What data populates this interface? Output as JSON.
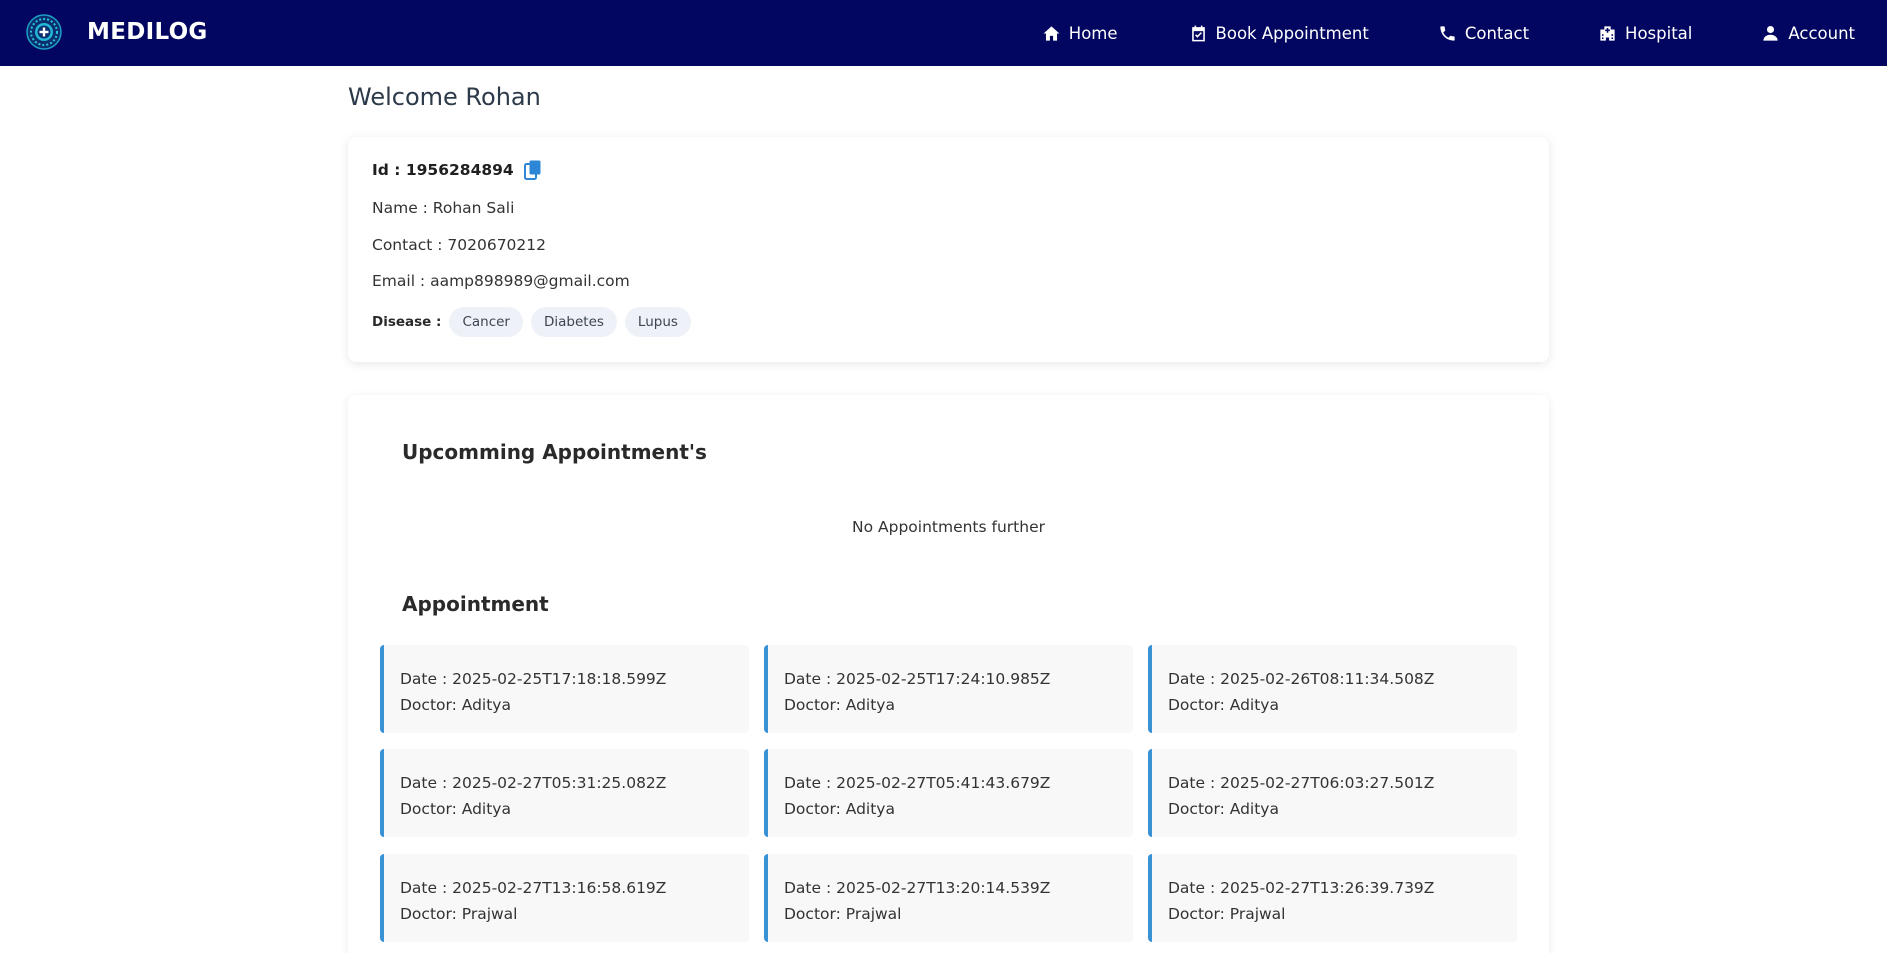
{
  "brand": {
    "name": "MEDILOG",
    "logo_icon": "medical-cross-icon"
  },
  "colors": {
    "navbar": "#020660",
    "accent": "#3a92d4",
    "chip_bg": "#eef2f8",
    "card_bg": "#f8f8f8"
  },
  "nav": [
    {
      "label": "Home",
      "icon": "home-icon"
    },
    {
      "label": "Book Appointment",
      "icon": "calendar-check-icon"
    },
    {
      "label": "Contact",
      "icon": "phone-icon"
    },
    {
      "label": "Hospital",
      "icon": "hospital-icon"
    },
    {
      "label": "Account",
      "icon": "user-icon"
    }
  ],
  "welcome": "Welcome Rohan",
  "profile": {
    "id": "Id : 1956284894",
    "name": "Name : Rohan Sali",
    "contact": "Contact : 7020670212",
    "email": "Email : aamp898989@gmail.com",
    "disease_label": "Disease :",
    "diseases": [
      "Cancer",
      "Diabetes",
      "Lupus"
    ]
  },
  "upcoming": {
    "heading": "Upcomming Appointment's",
    "empty_message": "No Appointments further"
  },
  "appointments": {
    "heading": "Appointment",
    "items": [
      {
        "date": "Date : 2025-02-25T17:18:18.599Z",
        "doctor": "Doctor: Aditya"
      },
      {
        "date": "Date : 2025-02-25T17:24:10.985Z",
        "doctor": "Doctor: Aditya"
      },
      {
        "date": "Date : 2025-02-26T08:11:34.508Z",
        "doctor": "Doctor: Aditya"
      },
      {
        "date": "Date : 2025-02-27T05:31:25.082Z",
        "doctor": "Doctor: Aditya"
      },
      {
        "date": "Date : 2025-02-27T05:41:43.679Z",
        "doctor": "Doctor: Aditya"
      },
      {
        "date": "Date : 2025-02-27T06:03:27.501Z",
        "doctor": "Doctor: Aditya"
      },
      {
        "date": "Date : 2025-02-27T13:16:58.619Z",
        "doctor": "Doctor: Prajwal"
      },
      {
        "date": "Date : 2025-02-27T13:20:14.539Z",
        "doctor": "Doctor: Prajwal"
      },
      {
        "date": "Date : 2025-02-27T13:26:39.739Z",
        "doctor": "Doctor: Prajwal"
      }
    ]
  }
}
